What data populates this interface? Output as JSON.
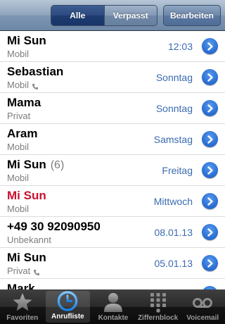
{
  "navbar": {
    "segments": [
      {
        "label": "Alle",
        "active": true
      },
      {
        "label": "Verpasst",
        "active": false
      }
    ],
    "edit_label": "Bearbeiten"
  },
  "calls": [
    {
      "name": "Mi Sun",
      "count": "",
      "type": "Mobil",
      "time": "12:03",
      "missed": false,
      "has_phone_icon": false
    },
    {
      "name": "Sebastian",
      "count": "",
      "type": "Mobil",
      "time": "Sonntag",
      "missed": false,
      "has_phone_icon": true
    },
    {
      "name": "Mama",
      "count": "",
      "type": "Privat",
      "time": "Sonntag",
      "missed": false,
      "has_phone_icon": false
    },
    {
      "name": "Aram",
      "count": "",
      "type": "Mobil",
      "time": "Samstag",
      "missed": false,
      "has_phone_icon": false
    },
    {
      "name": "Mi Sun",
      "count": "(6)",
      "type": "Mobil",
      "time": "Freitag",
      "missed": false,
      "has_phone_icon": false
    },
    {
      "name": "Mi Sun",
      "count": "",
      "type": "Mobil",
      "time": "Mittwoch",
      "missed": true,
      "has_phone_icon": false
    },
    {
      "name": "+49 30 92090950",
      "count": "",
      "type": "Unbekannt",
      "time": "08.01.13",
      "missed": false,
      "has_phone_icon": false
    },
    {
      "name": "Mi Sun",
      "count": "",
      "type": "Privat",
      "time": "05.01.13",
      "missed": false,
      "has_phone_icon": true
    },
    {
      "name": "Mark",
      "count": "",
      "type": "",
      "time": "",
      "missed": false,
      "has_phone_icon": false
    }
  ],
  "tabs": [
    {
      "label": "Favoriten",
      "icon": "star-icon",
      "selected": false
    },
    {
      "label": "Anrufliste",
      "icon": "clock-icon",
      "selected": true
    },
    {
      "label": "Kontakte",
      "icon": "contact-icon",
      "selected": false
    },
    {
      "label": "Ziffernblock",
      "icon": "keypad-icon",
      "selected": false
    },
    {
      "label": "Voicemail",
      "icon": "voicemail-icon",
      "selected": false
    }
  ],
  "colors": {
    "accent_blue": "#3b6bb0",
    "missed_red": "#c8102e",
    "navbar": "#6d87a7"
  }
}
